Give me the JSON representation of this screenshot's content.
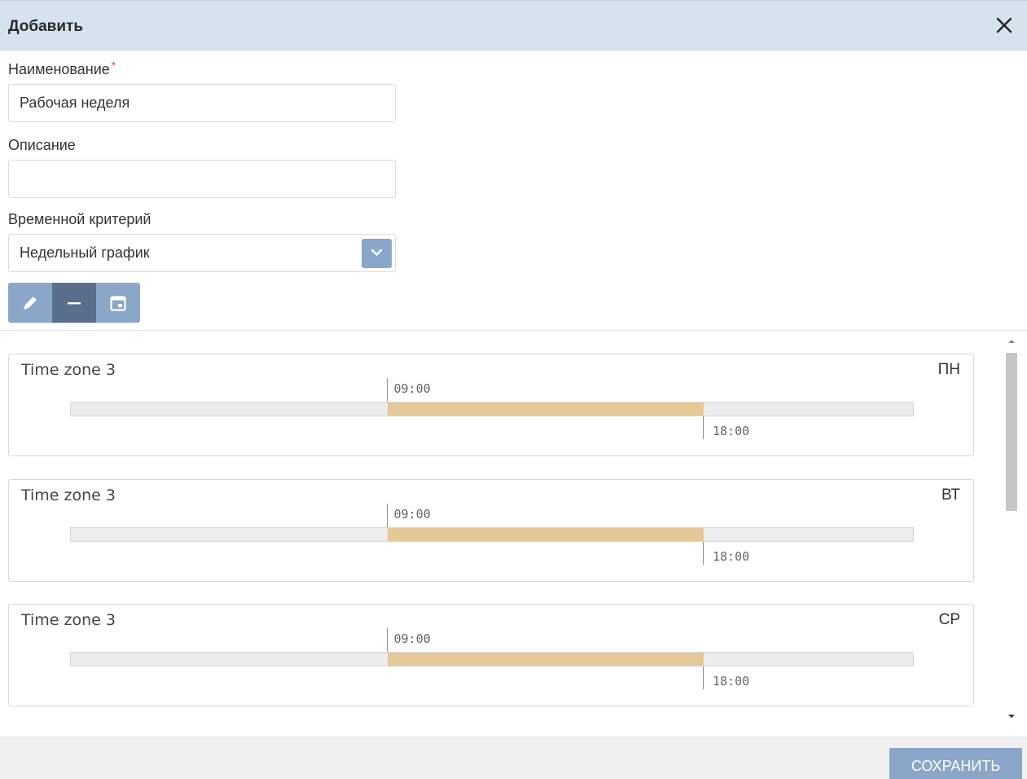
{
  "dialog": {
    "title": "Добавить",
    "close_icon": "close-icon"
  },
  "form": {
    "name_label": "Наименование",
    "required_mark": "*",
    "name_value": "Рабочая неделя",
    "description_label": "Описание",
    "description_value": "",
    "criterion_label": "Временной критерий",
    "criterion_value": "Недельный график"
  },
  "toolbar": {
    "buttons": [
      "pencil-icon",
      "minus-icon",
      "calendar-icon"
    ],
    "colors": {
      "normal": "#8aa6c9",
      "active": "#5a6f8b"
    }
  },
  "schedule": {
    "range_color": "#e4c896",
    "days": [
      {
        "zone": "Time zone 3",
        "day": "ПН",
        "start": "09:00",
        "end": "18:00"
      },
      {
        "zone": "Time zone 3",
        "day": "ВТ",
        "start": "09:00",
        "end": "18:00"
      },
      {
        "zone": "Time zone 3",
        "day": "СР",
        "start": "09:00",
        "end": "18:00"
      }
    ]
  },
  "footer": {
    "save_label": "СОХРАНИТЬ"
  }
}
